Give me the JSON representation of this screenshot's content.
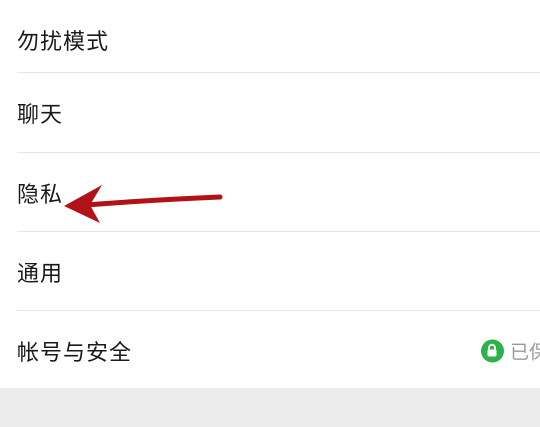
{
  "settings": {
    "items": [
      {
        "label": "勿扰模式"
      },
      {
        "label": "聊天"
      },
      {
        "label": "隐私"
      },
      {
        "label": "通用"
      },
      {
        "label": "帐号与安全",
        "status": "已保"
      }
    ]
  },
  "annotation": {
    "arrow_color": "#b11218",
    "points_to": "隐私"
  },
  "colors": {
    "status_green": "#2bb34a",
    "text": "#1a1a1a",
    "status_text": "#9a9a9a"
  },
  "icons": {
    "status": "lock-icon"
  }
}
